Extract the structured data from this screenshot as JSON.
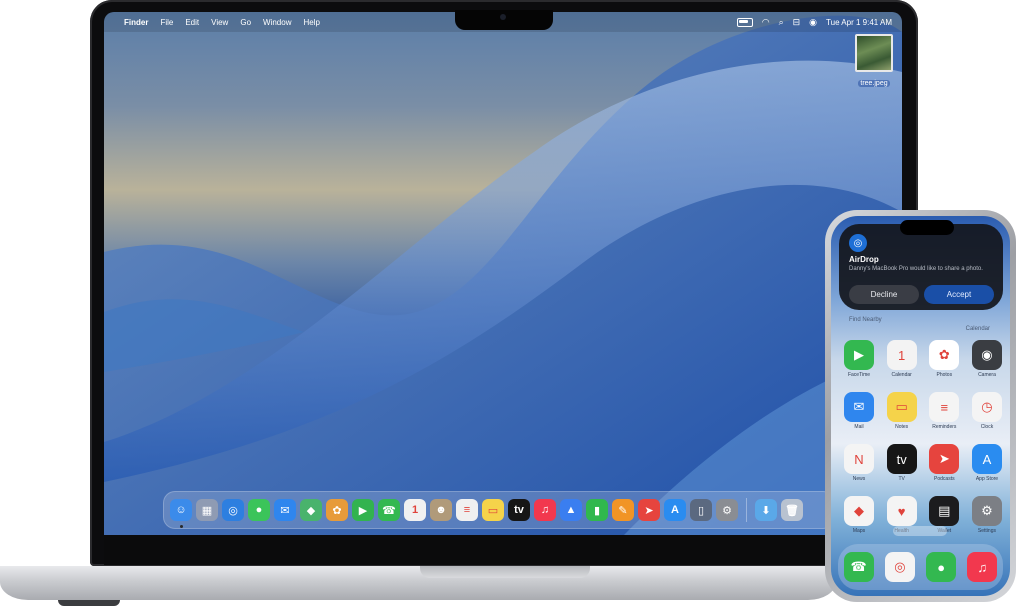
{
  "mac": {
    "menubar": {
      "apple_glyph": "",
      "app_name": "Finder",
      "menus": [
        "File",
        "Edit",
        "View",
        "Go",
        "Window",
        "Help"
      ],
      "datetime": "Tue Apr 1  9:41 AM"
    },
    "desktop_file": {
      "label": "tree.jpeg"
    },
    "dock_icons": [
      {
        "name": "finder-icon",
        "glyph": "☺",
        "color": "#3b8bea"
      },
      {
        "name": "launchpad-icon",
        "glyph": "▦",
        "color": "#8f9bb3"
      },
      {
        "name": "safari-icon",
        "glyph": "◎",
        "color": "#2d7fe0"
      },
      {
        "name": "messages-icon",
        "glyph": "●",
        "color": "#3bc45a"
      },
      {
        "name": "mail-icon",
        "glyph": "✉",
        "color": "#2f86ee"
      },
      {
        "name": "maps-icon",
        "glyph": "◆",
        "color": "#49b36c"
      },
      {
        "name": "photos-icon",
        "glyph": "✿",
        "color": "#e79b3a"
      },
      {
        "name": "facetime-icon",
        "glyph": "▶",
        "color": "#32b34f"
      },
      {
        "name": "phone-icon",
        "glyph": "☎",
        "color": "#33b850"
      },
      {
        "name": "calendar-icon",
        "glyph": "1",
        "color": "#f1f1f1"
      },
      {
        "name": "contacts-icon",
        "glyph": "☻",
        "color": "#b09a7a"
      },
      {
        "name": "reminders-icon",
        "glyph": "≡",
        "color": "#f0f0f0"
      },
      {
        "name": "notes-icon",
        "glyph": "▭",
        "color": "#f5d34a"
      },
      {
        "name": "tv-icon",
        "glyph": "tv",
        "color": "#161616"
      },
      {
        "name": "music-icon",
        "glyph": "♫",
        "color": "#f2384e"
      },
      {
        "name": "keynote-icon",
        "glyph": "▲",
        "color": "#3a7ef0"
      },
      {
        "name": "numbers-icon",
        "glyph": "▮",
        "color": "#30b84d"
      },
      {
        "name": "pages-icon",
        "glyph": "✎",
        "color": "#f19426"
      },
      {
        "name": "rocket-icon",
        "glyph": "➤",
        "color": "#e6443e"
      },
      {
        "name": "app-store-icon",
        "glyph": "A",
        "color": "#2a8cf0"
      },
      {
        "name": "iphone-mirroring-icon",
        "glyph": "▯",
        "color": "#5b6980"
      },
      {
        "name": "system-settings-icon",
        "glyph": "⚙",
        "color": "#8a8d93"
      }
    ],
    "dock_extra_icons": [
      {
        "name": "downloads-folder-icon",
        "glyph": "⬇",
        "color": "#5aa8e8"
      },
      {
        "name": "trash-icon",
        "glyph": "🗑",
        "color": "#b8c2d0"
      }
    ]
  },
  "iphone": {
    "airdrop": {
      "title": "AirDrop",
      "message": "Danny's MacBook Pro would like to share a photo.",
      "decline_label": "Decline",
      "accept_label": "Accept"
    },
    "widgets": {
      "left": "Find Nearby",
      "right": "Calendar"
    },
    "apps": [
      [
        {
          "name": "facetime-app",
          "label": "FaceTime",
          "glyph": "▶",
          "color": "#33b850"
        },
        {
          "name": "calendar-app",
          "label": "Calendar",
          "glyph": "1",
          "color": "#f3f3f3"
        },
        {
          "name": "photos-app",
          "label": "Photos",
          "glyph": "✿",
          "color": "#ffffff"
        },
        {
          "name": "camera-app",
          "label": "Camera",
          "glyph": "◉",
          "color": "#3a3d42"
        }
      ],
      [
        {
          "name": "mail-app",
          "label": "Mail",
          "glyph": "✉",
          "color": "#2f86ee"
        },
        {
          "name": "notes-app",
          "label": "Notes",
          "glyph": "▭",
          "color": "#f5d34a"
        },
        {
          "name": "reminders-app",
          "label": "Reminders",
          "glyph": "≡",
          "color": "#f4f4f4"
        },
        {
          "name": "clock-app",
          "label": "Clock",
          "glyph": "◷",
          "color": "#f4f4f4"
        }
      ],
      [
        {
          "name": "news-app",
          "label": "News",
          "glyph": "N",
          "color": "#f4f4f4"
        },
        {
          "name": "tv-app",
          "label": "TV",
          "glyph": "tv",
          "color": "#161616"
        },
        {
          "name": "rocket-app",
          "label": "Podcasts",
          "glyph": "➤",
          "color": "#e6443e"
        },
        {
          "name": "app-store-app",
          "label": "App Store",
          "glyph": "A",
          "color": "#2a8cf0"
        }
      ],
      [
        {
          "name": "maps-app",
          "label": "Maps",
          "glyph": "◆",
          "color": "#f4f4f4"
        },
        {
          "name": "health-app",
          "label": "Health",
          "glyph": "♥",
          "color": "#f4f4f4"
        },
        {
          "name": "wallet-app",
          "label": "Wallet",
          "glyph": "▤",
          "color": "#1c1c1e"
        },
        {
          "name": "settings-app",
          "label": "Settings",
          "glyph": "⚙",
          "color": "#7c7f85"
        }
      ]
    ],
    "dock": [
      {
        "name": "phone-app",
        "glyph": "☎",
        "color": "#33b850"
      },
      {
        "name": "safari-app",
        "glyph": "◎",
        "color": "#f4f4f4"
      },
      {
        "name": "messages-app",
        "glyph": "●",
        "color": "#33b850"
      },
      {
        "name": "music-app",
        "glyph": "♫",
        "color": "#f2384e"
      }
    ]
  }
}
